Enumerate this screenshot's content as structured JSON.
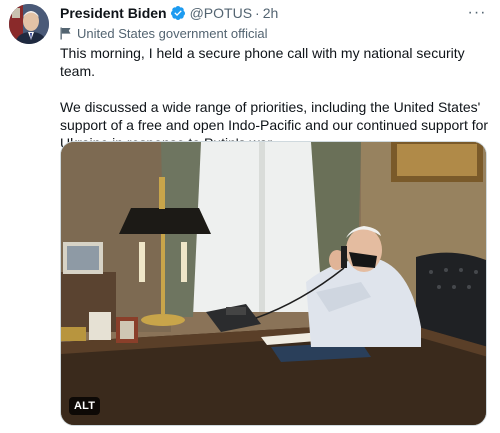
{
  "author": {
    "display_name": "President Biden",
    "handle": "@POTUS",
    "separator": "·",
    "timestamp": "2h",
    "verified_color": "#1d9bf0"
  },
  "account_label": {
    "icon": "flag-icon",
    "text": "United States government official"
  },
  "tweet": {
    "paragraph_1": "This morning, I held a secure phone call with my national security team.",
    "paragraph_2": "We discussed a wide range of priorities, including the United States' support of a free and open Indo-Pacific and our continued support for Ukraine in response to Putin's war."
  },
  "media": {
    "alt_badge": "ALT"
  },
  "menu": {
    "icon": "more-options-icon",
    "glyph": "···"
  }
}
